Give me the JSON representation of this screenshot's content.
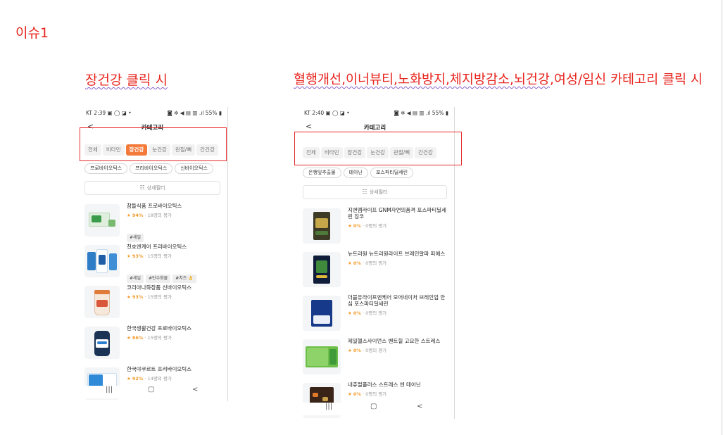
{
  "slide": {
    "title": "이슈1",
    "caption_left": "장건강 클릭 시",
    "caption_right_parts": [
      "혈행개선,이너뷰티,노화방지,체지방감소,뇌건강",
      ",여성/임신 카테고리 클릭 시"
    ]
  },
  "phone1": {
    "status_left": "KT 2:39 ▣ ◯ ◪ •",
    "status_right": "◙ ✲ ◀ ▤ ▥ .ıl 55% ▮",
    "back_glyph": "<",
    "title": "카테고리",
    "tabs": [
      {
        "label": "전체",
        "active": false
      },
      {
        "label": "비타민",
        "active": false
      },
      {
        "label": "장건강",
        "active": true
      },
      {
        "label": "눈건강",
        "active": false
      },
      {
        "label": "관절/뼈",
        "active": false
      },
      {
        "label": "간건강",
        "active": false
      }
    ],
    "chips": [
      "프로바이오틱스",
      "프리바이오틱스",
      "신바이오틱스"
    ],
    "filter_label": "상세필터",
    "products": [
      {
        "name": "참들식품 프로바이오틱스",
        "score": "94%",
        "reviews": "18명의 평가",
        "tags": [
          "#세일"
        ]
      },
      {
        "name": "천호엔케어 프리바이오틱스",
        "score": "93%",
        "reviews": "15명의 평가",
        "tags": [
          "#세일",
          "#탄수화물",
          "#치즈 👌"
        ]
      },
      {
        "name": "코리아나화장품 신바이오틱스",
        "score": "93%",
        "reviews": "15명의 평가",
        "tags": []
      },
      {
        "name": "한국생활건강 프로바이오틱스",
        "score": "86%",
        "reviews": "15명의 평가",
        "tags": []
      },
      {
        "name": "한국야쿠르트 프리바이오틱스",
        "score": "92%",
        "reviews": "14명의 평가",
        "tags": []
      }
    ],
    "nav": [
      "|||",
      "▢",
      "<"
    ]
  },
  "phone2": {
    "status_left": "KT 2:40 ▣ ◯ ◪ •",
    "status_right": "◙ ✲ ◀ ▤ ▥ .ıl 55% ▮",
    "back_glyph": "<",
    "title": "카테고리",
    "tabs": [
      {
        "label": "전체",
        "active": false
      },
      {
        "label": "비타민",
        "active": false
      },
      {
        "label": "장건강",
        "active": false
      },
      {
        "label": "눈건강",
        "active": false
      },
      {
        "label": "관절/뼈",
        "active": false
      },
      {
        "label": "간건강",
        "active": false
      }
    ],
    "chips": [
      "은행잎추출물",
      "테아닌",
      "포스파티딜세린"
    ],
    "filter_label": "상세필터",
    "products": [
      {
        "name": "지엔엠라이프 GNM자연의품격 포스파티딜세린 징코",
        "score": "0%",
        "reviews": "0명의 평가"
      },
      {
        "name": "뉴트리원 뉴트리원라이프 브레인알파 피에스",
        "score": "0%",
        "reviews": "0명의 평가"
      },
      {
        "name": "더블유라이프엔케어 모어네이처 브레인업 안심 포스파티딜세린",
        "score": "0%",
        "reviews": "0명의 평가"
      },
      {
        "name": "제일헬스사이언스 벤트힐 고요한 스트레스",
        "score": "0%",
        "reviews": "0명의 평가"
      },
      {
        "name": "내츄럴플러스 스트레스 엔 테아닌",
        "score": "0%",
        "reviews": "0명의 평가"
      }
    ],
    "nav": [
      "|||",
      "▢",
      "<"
    ]
  },
  "colors": {
    "annotation_red": "#e8251e",
    "active_tab": "#f47a3a",
    "star": "#f39b2b"
  }
}
